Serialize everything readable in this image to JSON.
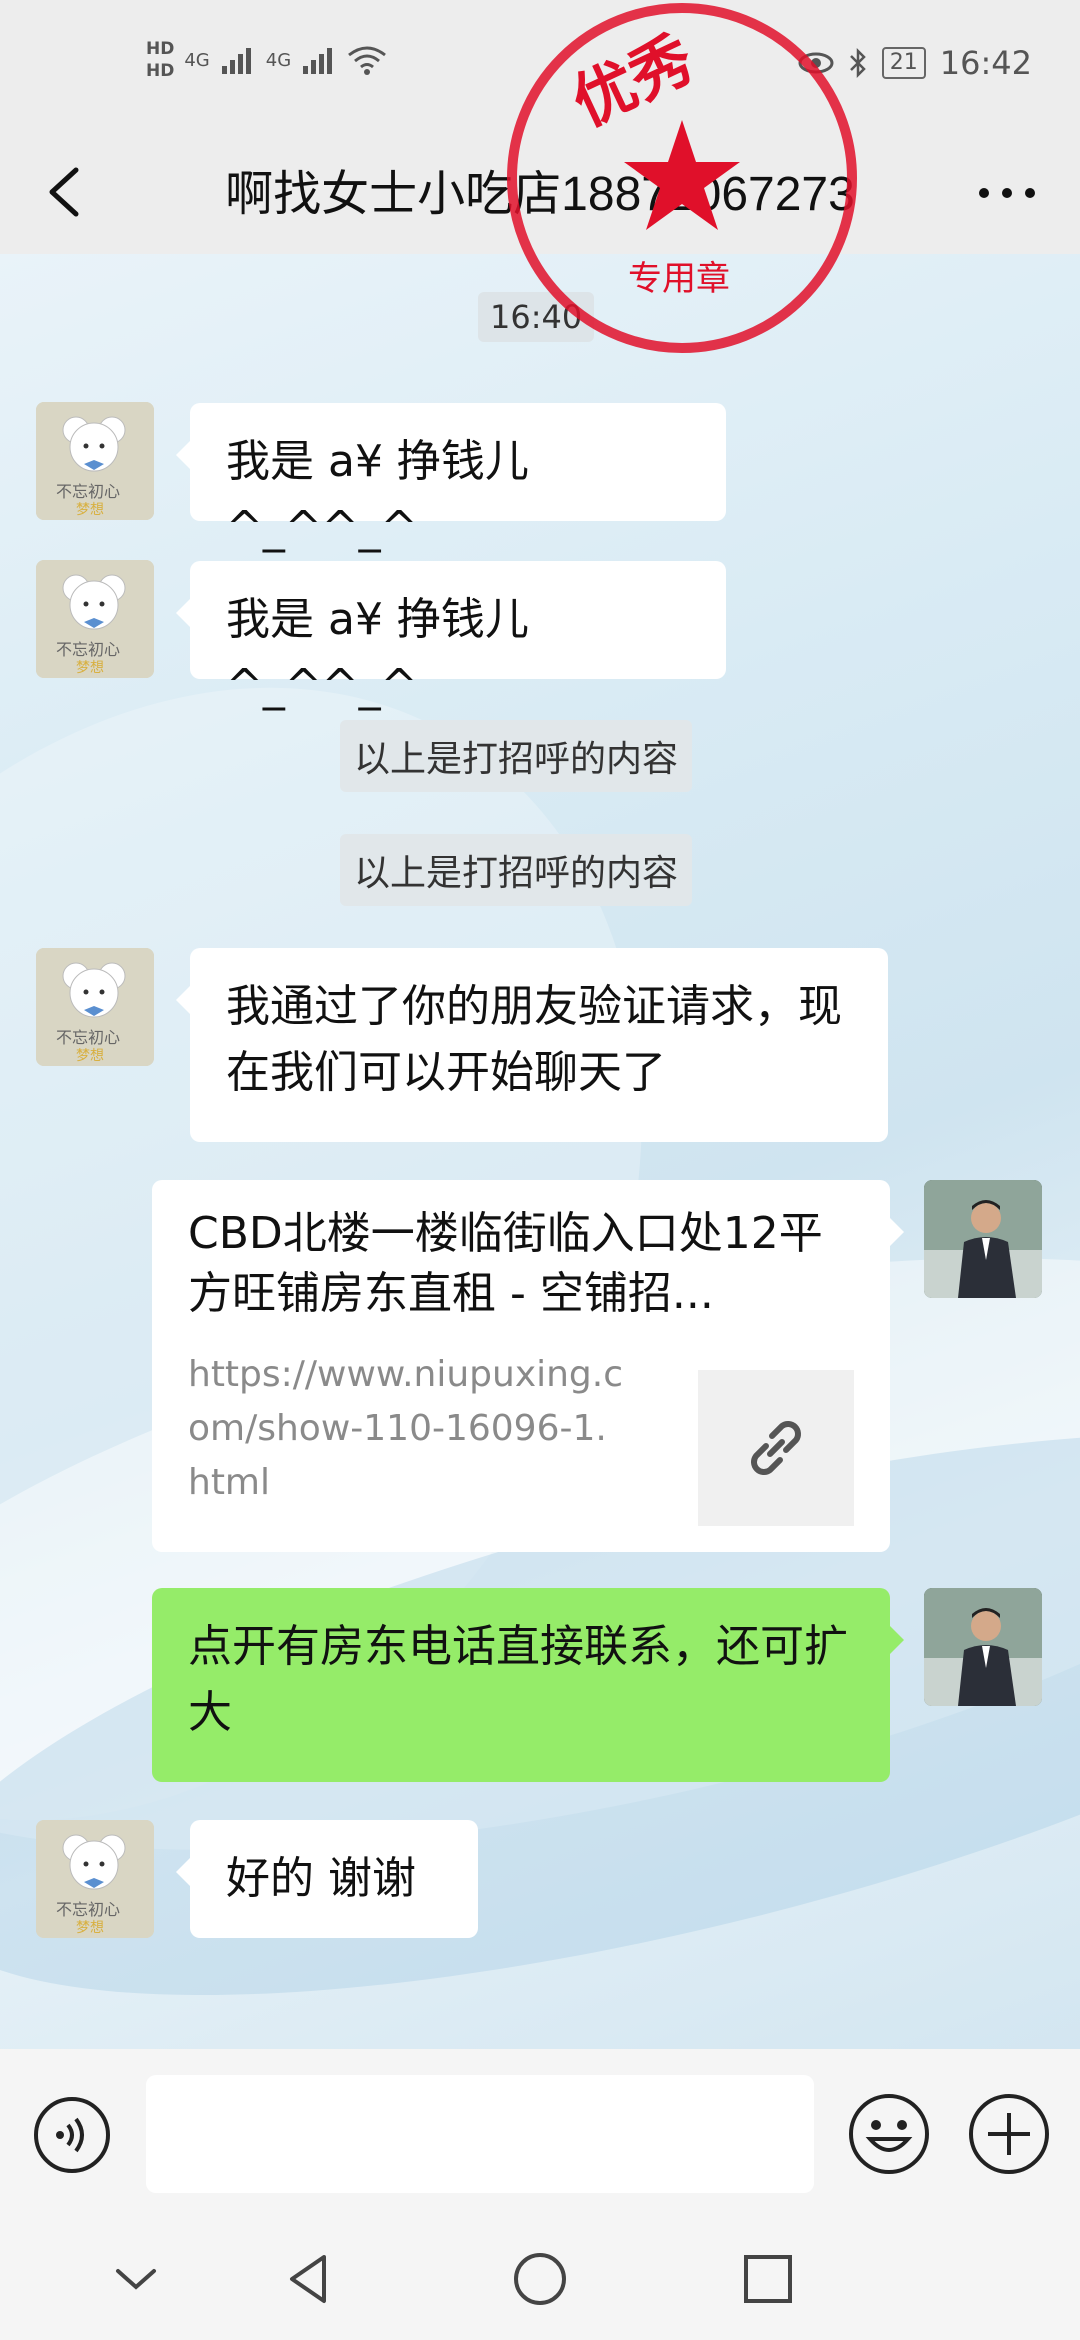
{
  "status_bar": {
    "time": "16:42",
    "battery": "21",
    "hd1": "HD",
    "hd2": "HD",
    "net1": "4G",
    "net2": "4G"
  },
  "header": {
    "title": "啊找女士小吃店18872067273"
  },
  "chat": {
    "time_label": "16:40",
    "messages": [
      {
        "side": "left",
        "text": "我是 a¥ 挣钱儿 ^_^^_^"
      },
      {
        "side": "left",
        "text": "我是 a¥ 挣钱儿 ^_^^_^"
      },
      {
        "side": "system",
        "text": "以上是打招呼的内容"
      },
      {
        "side": "system",
        "text": "以上是打招呼的内容"
      },
      {
        "side": "left",
        "text": "我通过了你的朋友验证请求，现在我们可以开始聊天了"
      },
      {
        "side": "right",
        "type": "link",
        "title": "CBD北楼一楼临街临入口处12平方旺铺房东直租 - 空铺招...",
        "url": "https://www.niupuxing.com/show-110-16096-1.html"
      },
      {
        "side": "right",
        "text": "点开有房东电话直接联系，还可扩大"
      },
      {
        "side": "left",
        "text": "好的 谢谢"
      }
    ]
  },
  "stamp": {
    "text_top": "优秀",
    "text_bottom": "专用章"
  },
  "input_bar": {
    "value": "",
    "placeholder": ""
  },
  "colors": {
    "green_bubble": "#95ec69",
    "stamp_red": "#e0102a"
  }
}
